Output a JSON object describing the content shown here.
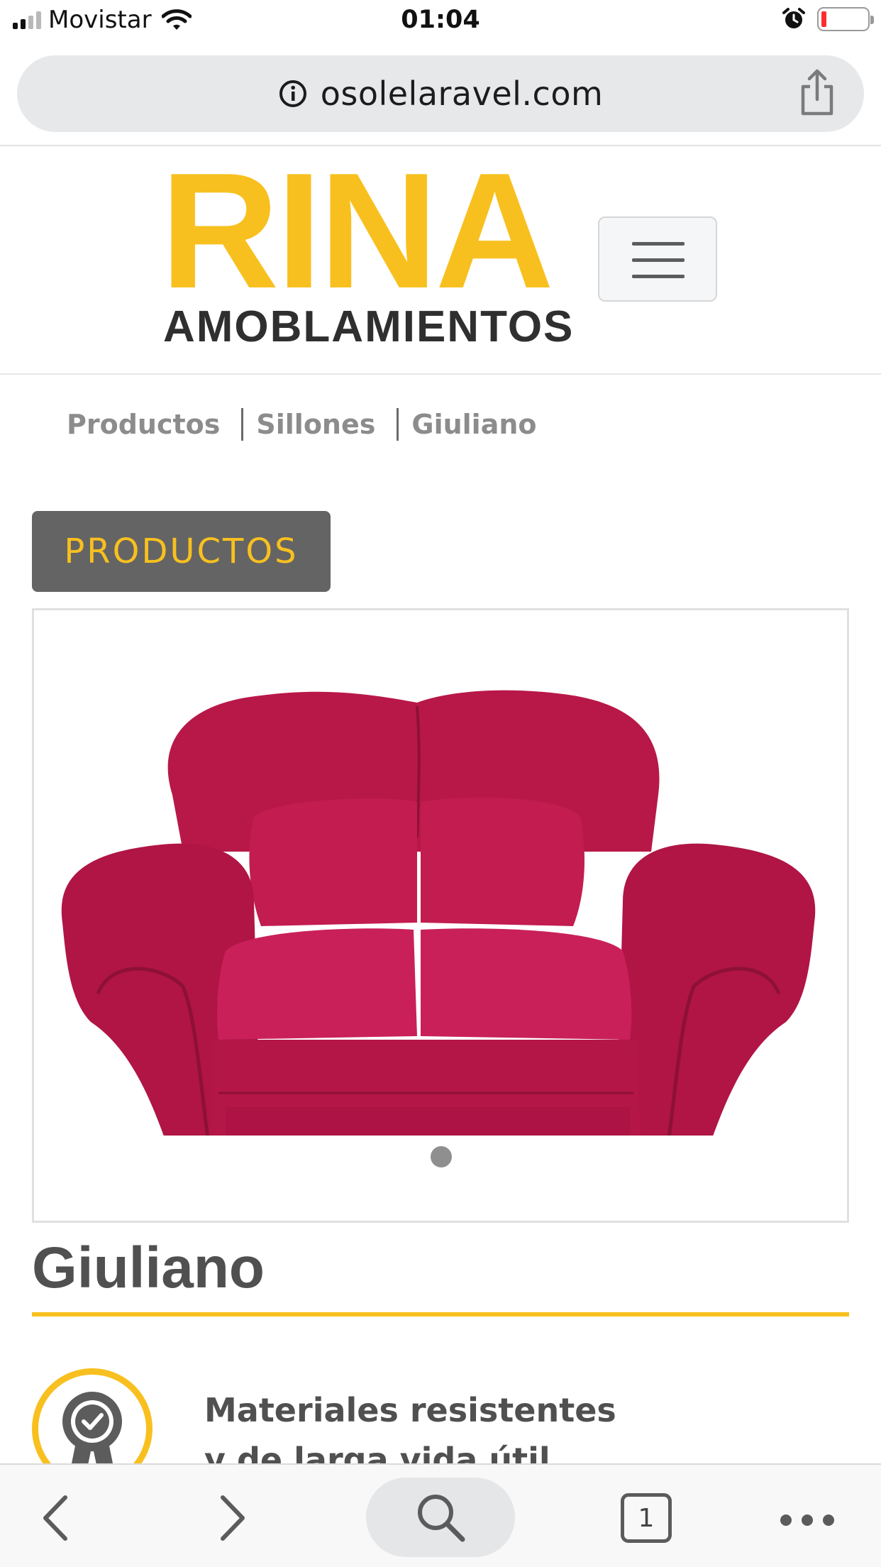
{
  "status_bar": {
    "carrier": "Movistar",
    "time": "01:04",
    "battery_color": "#ff2d2d"
  },
  "browser": {
    "url": "osolelaravel.com",
    "info_icon": "info-circle-icon",
    "share_icon": "share-icon"
  },
  "header": {
    "logo_main": "RINA",
    "logo_sub": "AMOBLAMIENTOS",
    "menu_icon": "hamburger-menu-icon",
    "brand_color": "#f8c01f"
  },
  "breadcrumb": {
    "items": [
      "Productos",
      "Sillones",
      "Giuliano"
    ]
  },
  "products_button": {
    "label": "PRODUCTOS"
  },
  "carousel": {
    "image": "red-sofa",
    "active_slide": 1,
    "slide_count": 1
  },
  "product": {
    "title": "Giuliano"
  },
  "feature": {
    "icon": "quality-badge-icon",
    "line1": "Materiales resistentes",
    "line2": "y de larga vida útil"
  },
  "toolbar": {
    "back_icon": "chevron-left-icon",
    "forward_icon": "chevron-right-icon",
    "search_icon": "search-icon",
    "tab_count": "1",
    "more_icon": "more-dots-icon"
  }
}
